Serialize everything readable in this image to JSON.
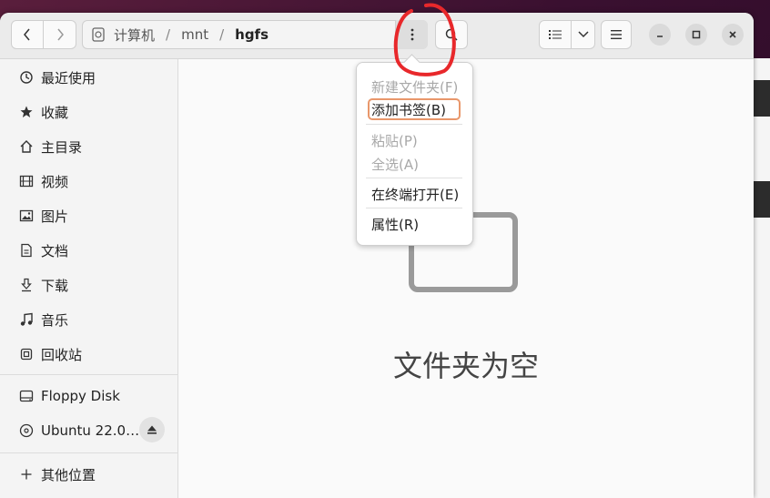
{
  "path": {
    "segments": [
      "计算机",
      "mnt",
      "hgfs"
    ]
  },
  "sidebar": {
    "places": [
      {
        "label": "最近使用",
        "icon": "clock-icon"
      },
      {
        "label": "收藏",
        "icon": "star-icon"
      },
      {
        "label": "主目录",
        "icon": "home-icon"
      },
      {
        "label": "视频",
        "icon": "film-icon"
      },
      {
        "label": "图片",
        "icon": "image-icon"
      },
      {
        "label": "文档",
        "icon": "document-icon"
      },
      {
        "label": "下载",
        "icon": "download-icon"
      },
      {
        "label": "音乐",
        "icon": "music-icon"
      },
      {
        "label": "回收站",
        "icon": "trash-icon"
      }
    ],
    "devices": [
      {
        "label": "Floppy Disk",
        "icon": "floppy-icon"
      },
      {
        "label": "Ubuntu 22.0…",
        "icon": "disc-icon"
      }
    ],
    "other": {
      "label": "其他位置",
      "icon": "plus-icon"
    }
  },
  "content": {
    "empty_label": "文件夹为空"
  },
  "context_menu": {
    "items": [
      {
        "label": "新建文件夹(F)",
        "enabled": false
      },
      {
        "label": "添加书签(B)",
        "enabled": true
      },
      {
        "label": "粘贴(P)",
        "enabled": false
      },
      {
        "label": "全选(A)",
        "enabled": false
      },
      {
        "label": "在终端打开(E)",
        "enabled": true
      },
      {
        "label": "属性(R)",
        "enabled": true
      }
    ]
  },
  "colors": {
    "accent_focus": "#e9976b",
    "annotation_red": "#e8282b",
    "desktop_bg": "#3a1030"
  }
}
